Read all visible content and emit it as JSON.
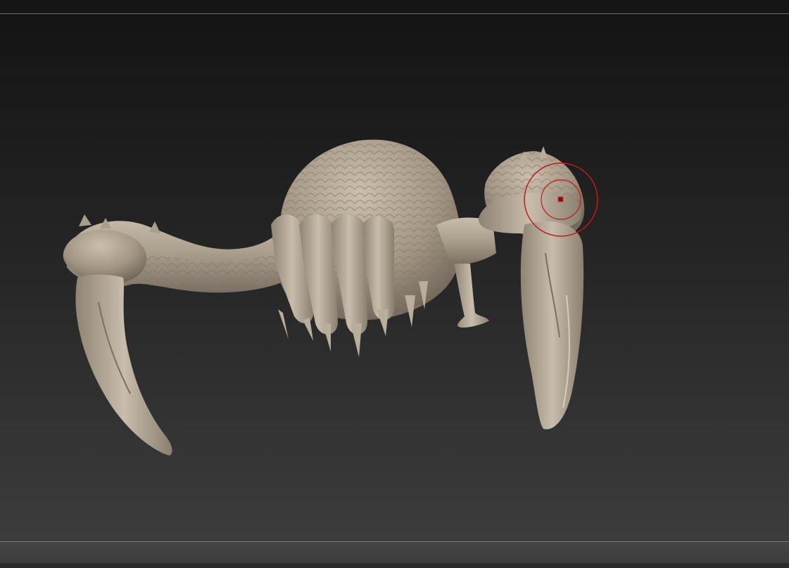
{
  "window": {
    "title": "",
    "background_top": "#141414",
    "background_bottom": "#3c3c3c"
  },
  "canvas": {
    "model_material_color": "#b0a493",
    "model_shadow_color": "#6f655a",
    "model_highlight_color": "#d4c9b8"
  },
  "brush_cursor": {
    "icon": "brush-cursor-icon",
    "color": "#c01a1a"
  }
}
